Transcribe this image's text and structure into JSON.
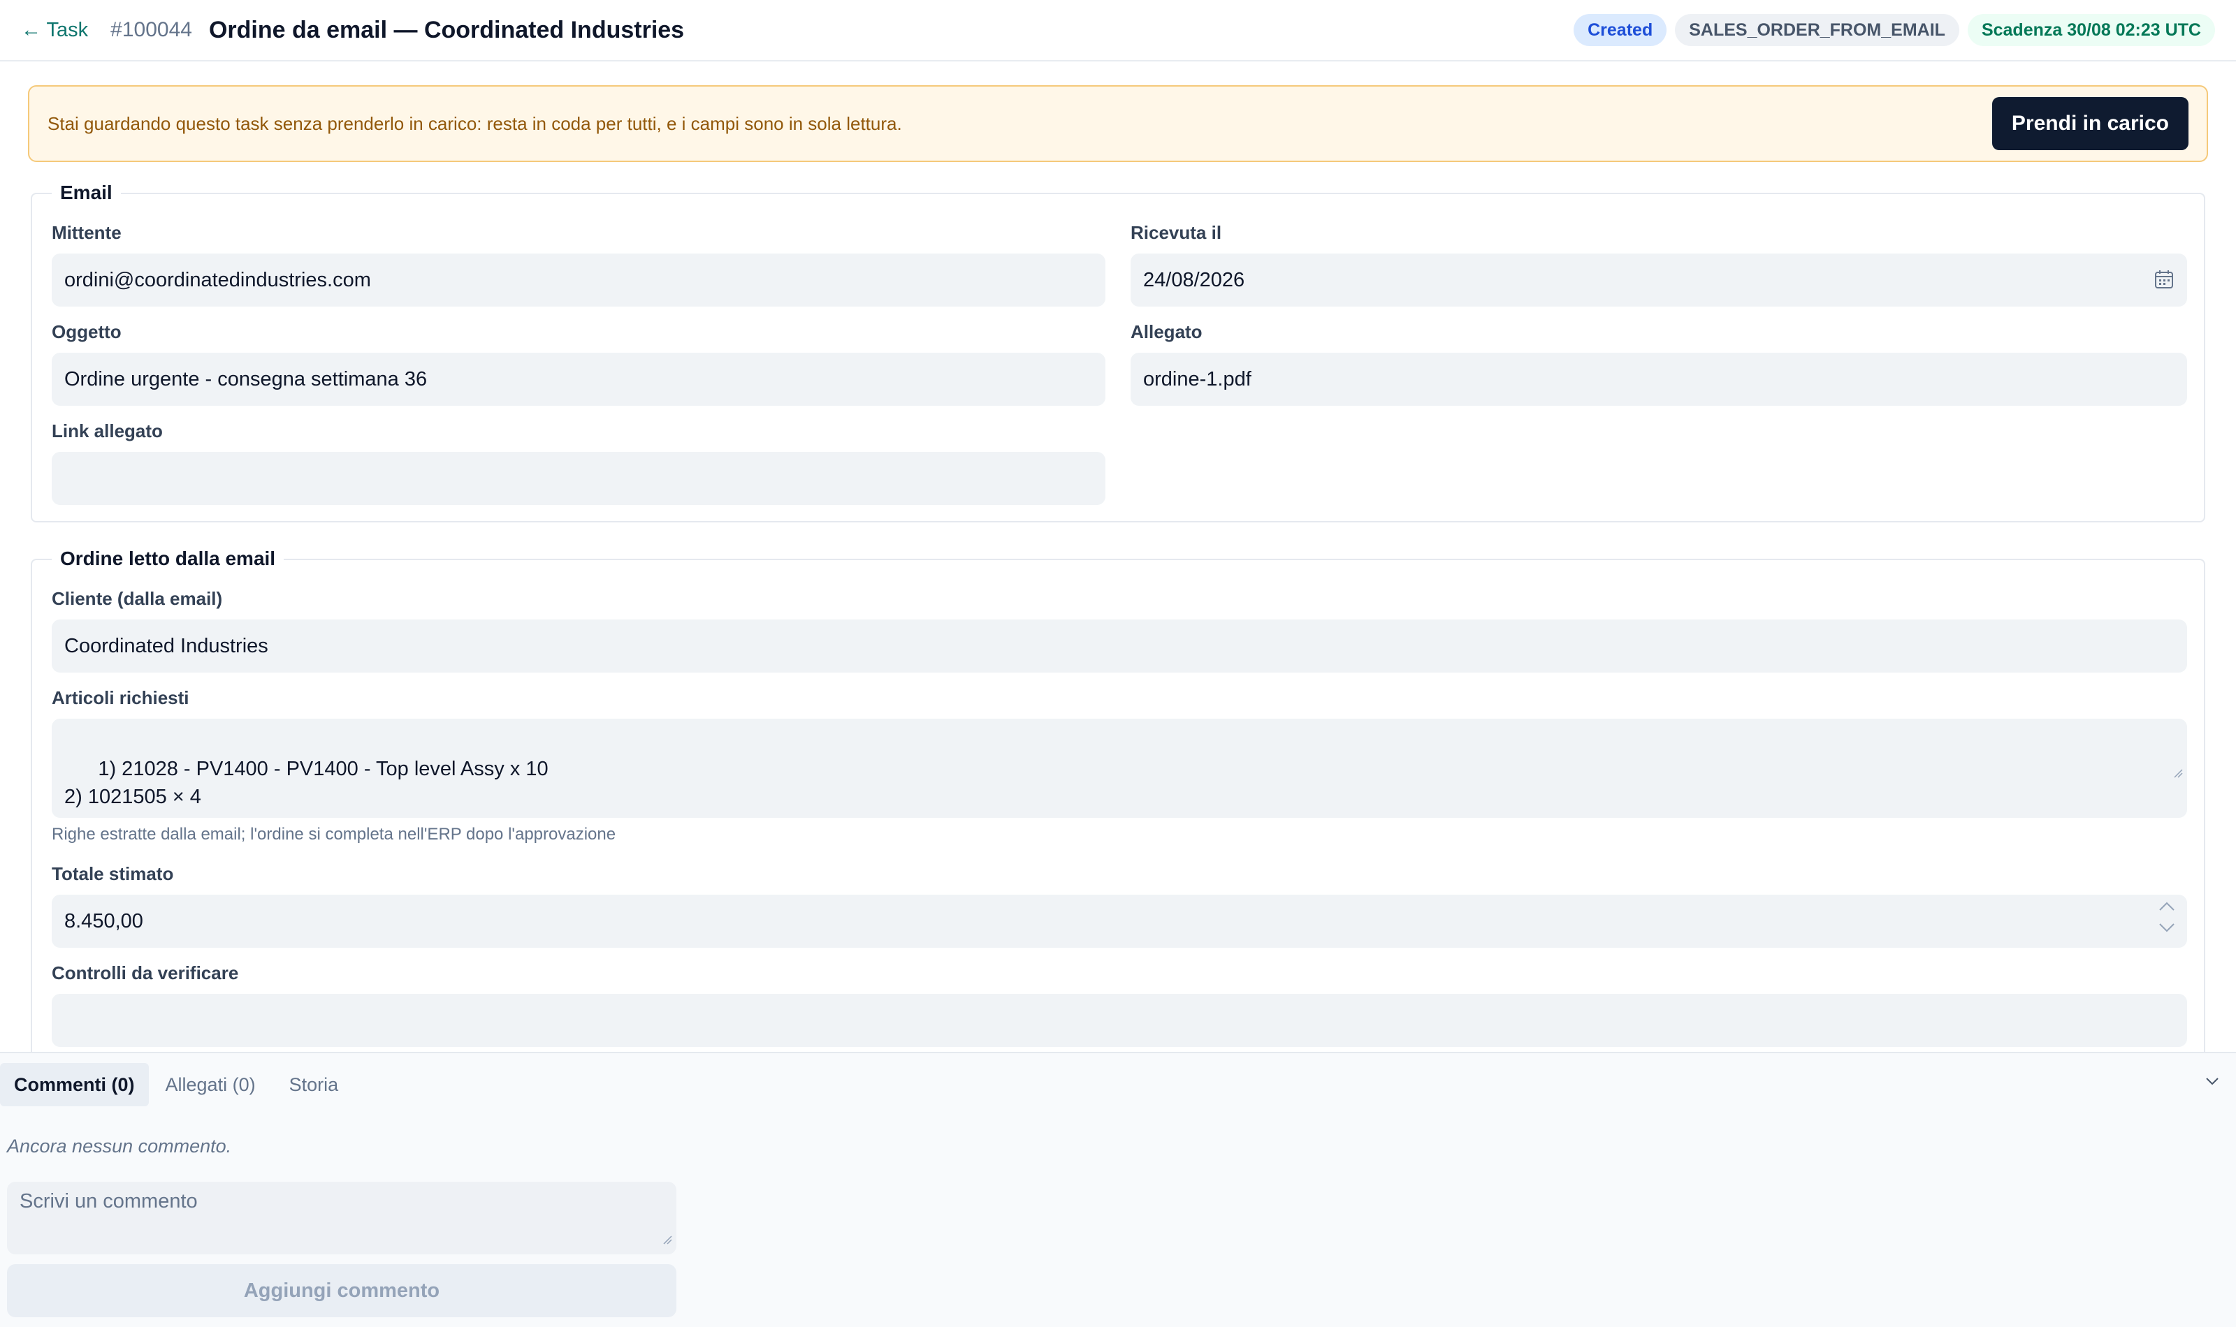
{
  "header": {
    "back_label": "← Task",
    "task_id": "#100044",
    "title": "Ordine da email — Coordinated Industries",
    "status_badge": "Created",
    "type_badge": "SALES_ORDER_FROM_EMAIL",
    "due_badge": "Scadenza 30/08 02:23 UTC"
  },
  "banner": {
    "text": "Stai guardando questo task senza prenderlo in carico: resta in coda per tutti, e i campi sono in sola lettura.",
    "button_label": "Prendi in carico"
  },
  "email_section": {
    "legend": "Email",
    "sender_label": "Mittente",
    "sender_value": "ordini@coordinatedindustries.com",
    "received_label": "Ricevuta il",
    "received_value": "24/08/2026",
    "subject_label": "Oggetto",
    "subject_value": "Ordine urgente - consegna settimana 36",
    "attachment_label": "Allegato",
    "attachment_value": "ordine-1.pdf",
    "attachment_link_label": "Link allegato",
    "attachment_link_value": ""
  },
  "order_section": {
    "legend": "Ordine letto dalla email",
    "customer_label": "Cliente (dalla email)",
    "customer_value": "Coordinated Industries",
    "items_label": "Articoli richiesti",
    "items_value": "1) 21028 - PV1400 - PV1400 - Top level Assy x 10\n2) 1021505 × 4",
    "items_hint": "Righe estratte dalla email; l'ordine si completa nell'ERP dopo l'approvazione",
    "total_label": "Totale stimato",
    "total_value": "8.450,00",
    "checks_label": "Controlli da verificare",
    "checks_value": ""
  },
  "bottom": {
    "tabs": [
      {
        "label": "Commenti (0)"
      },
      {
        "label": "Allegati (0)"
      },
      {
        "label": "Storia"
      }
    ],
    "empty_text": "Ancora nessun commento.",
    "comment_placeholder": "Scrivi un commento",
    "add_button_label": "Aggiungi commento"
  },
  "icons": {
    "date": "calendar-icon",
    "collapse": "chevron-down-icon"
  }
}
